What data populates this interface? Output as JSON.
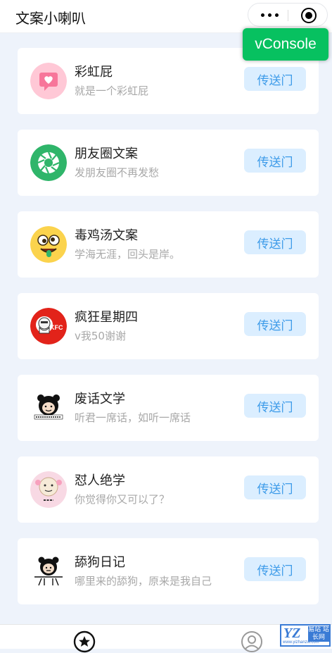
{
  "nav": {
    "title": "文案小喇叭"
  },
  "vconsole": {
    "label": "vConsole"
  },
  "items": [
    {
      "title": "彩虹屁",
      "subtitle": "就是一个彩虹屁",
      "button": "传送门",
      "icon": "heart-message-icon"
    },
    {
      "title": "朋友圈文案",
      "subtitle": "发朋友圈不再发愁",
      "button": "传送门",
      "icon": "camera-shutter-icon"
    },
    {
      "title": "毒鸡汤文案",
      "subtitle": "学海无涯，回头是岸。",
      "button": "传送门",
      "icon": "crazy-face-icon"
    },
    {
      "title": "疯狂星期四",
      "subtitle": "v我50谢谢",
      "button": "传送门",
      "icon": "kfc-logo-icon"
    },
    {
      "title": "废话文学",
      "subtitle": "听君一席话，如听一席话",
      "button": "传送门",
      "icon": "meme-face-icon"
    },
    {
      "title": "怼人绝学",
      "subtitle": "你觉得你又可以了？",
      "button": "传送门",
      "icon": "meme-face-icon"
    },
    {
      "title": "舔狗日记",
      "subtitle": "哪里来的舔狗，原来是我自己",
      "button": "传送门",
      "icon": "meme-face-icon"
    }
  ],
  "tabbar": {
    "tabs": [
      {
        "icon": "star-icon"
      },
      {
        "icon": "user-icon"
      }
    ]
  },
  "watermark": {
    "brand": "YZ",
    "cn": "易站 站长网",
    "url": "www.yizhanzw.com"
  },
  "colors": {
    "accent": "#3d9be9",
    "button_bg": "#dbeeff",
    "vconsole": "#07c160",
    "page_bg": "#eef3fb"
  }
}
